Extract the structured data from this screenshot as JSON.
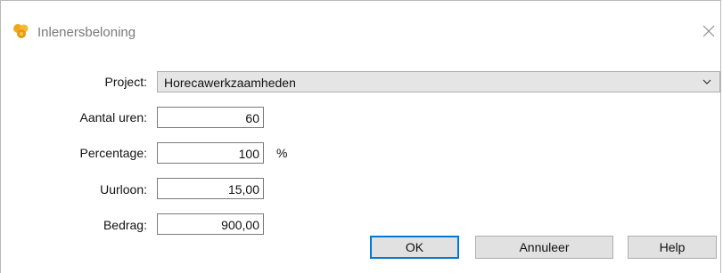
{
  "window": {
    "title": "Inlenersbeloning",
    "app_icon": "coins-icon",
    "close_icon": "close-icon"
  },
  "form": {
    "project": {
      "label": "Project:",
      "value": "Horecawerkzaamheden",
      "dropdown_icon": "chevron-down-icon"
    },
    "aantal_uren": {
      "label": "Aantal uren:",
      "value": "60"
    },
    "percentage": {
      "label": "Percentage:",
      "value": "100",
      "unit": "%"
    },
    "uurloon": {
      "label": "Uurloon:",
      "value": "15,00"
    },
    "bedrag": {
      "label": "Bedrag:",
      "value": "900,00"
    }
  },
  "buttons": {
    "ok": "OK",
    "cancel": "Annuleer",
    "help": "Help"
  },
  "colors": {
    "accent": "#0078d7",
    "icon_gold": "#f0a81c",
    "button_bg": "#e1e1e1",
    "select_bg": "#e5e5e5"
  }
}
